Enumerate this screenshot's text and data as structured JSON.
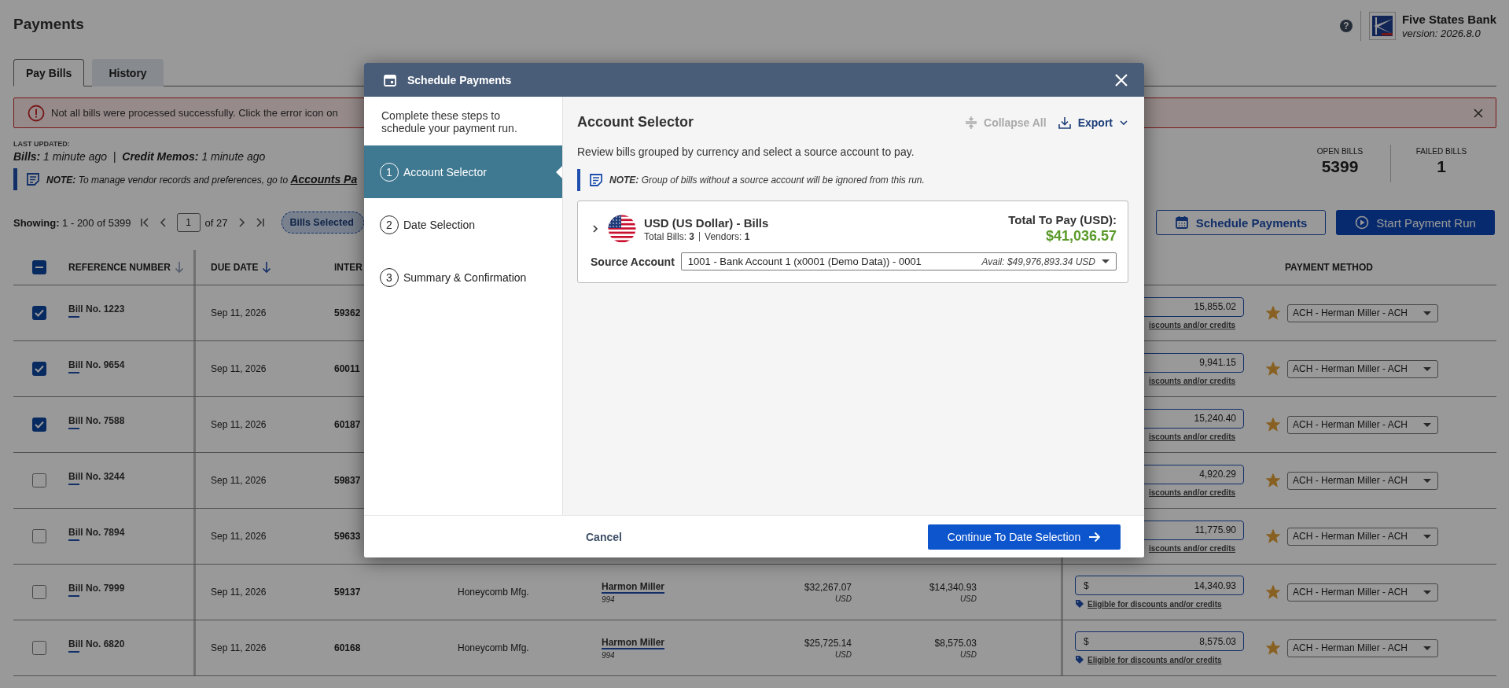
{
  "header": {
    "title": "Payments",
    "help": "?",
    "brand": {
      "name": "Five States Bank",
      "version": "version: 2026.8.0"
    }
  },
  "tabs": [
    {
      "label": "Pay Bills",
      "selected": true
    },
    {
      "label": "History",
      "selected": false
    }
  ],
  "alert": {
    "message": "Not all bills were processed successfully. Click the error icon on"
  },
  "last_updated": {
    "label": "LAST UPDATED:",
    "text": "**Bills:** 1 minute ago  |  **Credit Memos:** 1 minute ago"
  },
  "note": {
    "text": "**NOTE:** To manage vendor records and preferences, go to",
    "link": "Accounts Pa"
  },
  "stats": [
    {
      "label": "OPEN BILLS",
      "value": "5399"
    },
    {
      "label": "FAILED BILLS",
      "value": "1"
    }
  ],
  "pager": {
    "showing": "**Showing:** 1 - 200 of 5399",
    "page": "1",
    "of": "of 27",
    "pill": "Bills Selected"
  },
  "actions": [
    {
      "label": "Schedule Payments",
      "kind": "outline"
    },
    {
      "label": "Start Payment Run",
      "kind": "primary"
    }
  ],
  "table": {
    "indeterminate": true,
    "columns": [
      {
        "label": "REFERENCE NUMBER",
        "sortable": true,
        "sorted": false
      },
      {
        "label": "DUE DATE",
        "sortable": true,
        "sorted": true
      },
      {
        "label": "INTER",
        "sortable": false
      },
      {
        "label": "PAYMENT METHOD",
        "sortable": false
      }
    ],
    "rows": [
      {
        "checked": true,
        "reference": "Bill No. 1223",
        "due_date": "Sep 11, 2026",
        "column_3": "59362",
        "column_8": {
          "value": "15,855.02"
        },
        "link": {
          "text": "iscounts and/or credits",
          "tag_icon": false
        },
        "preferred": true,
        "payment_method": "ACH - Herman Miller - ACH"
      },
      {
        "checked": true,
        "reference": "Bill No. 9654",
        "due_date": "Sep 11, 2026",
        "column_3": "60011",
        "column_8": {
          "value": "9,941.15"
        },
        "link": {
          "text": "iscounts and/or credits",
          "tag_icon": false
        },
        "preferred": true,
        "payment_method": "ACH - Herman Miller - ACH"
      },
      {
        "checked": true,
        "reference": "Bill No. 7588",
        "due_date": "Sep 11, 2026",
        "column_3": "60187",
        "column_8": {
          "value": "15,240.40"
        },
        "link": {
          "text": "iscounts and/or credits",
          "tag_icon": false
        },
        "preferred": true,
        "payment_method": "ACH - Herman Miller - ACH"
      },
      {
        "checked": false,
        "reference": "Bill No. 3244",
        "due_date": "Sep 11, 2026",
        "column_3": "59837",
        "column_8": {
          "value": "4,920.29"
        },
        "link": {
          "text": "iscounts and/or credits",
          "tag_icon": false
        },
        "preferred": true,
        "payment_method": "ACH - Herman Miller - ACH"
      },
      {
        "checked": false,
        "reference": "Bill No. 7894",
        "due_date": "Sep 11, 2026",
        "column_3": "59633",
        "column_8": {
          "value": "11,775.90"
        },
        "link": {
          "text": "iscounts and/or credits",
          "tag_icon": false
        },
        "preferred": true,
        "payment_method": "ACH - Herman Miller - ACH"
      },
      {
        "checked": false,
        "reference": "Bill No. 7999",
        "due_date": "Sep 11, 2026",
        "column_3": "59137",
        "column_4": "Honeycomb Mfg.",
        "column_5": {
          "name": "Harmon Miller",
          "sub": "994"
        },
        "column_6": {
          "value": "$32,267.07",
          "unit": "USD"
        },
        "column_7": {
          "value": "$14,340.93",
          "unit": "USD"
        },
        "column_8": {
          "prefix": "$",
          "value": "14,340.93"
        },
        "link": {
          "text": "Eligible for discounts and/or credits",
          "tag_icon": true
        },
        "preferred": true,
        "payment_method": "ACH - Herman Miller - ACH"
      },
      {
        "checked": false,
        "reference": "Bill No. 6820",
        "due_date": "Sep 11, 2026",
        "column_3": "60168",
        "column_4": "Honeycomb Mfg.",
        "column_5": {
          "name": "Harmon Miller",
          "sub": "994"
        },
        "column_6": {
          "value": "$25,725.14",
          "unit": "USD"
        },
        "column_7": {
          "value": "$8,575.03",
          "unit": "USD"
        },
        "column_8": {
          "prefix": "$",
          "value": "8,575.03"
        },
        "link": {
          "text": "Eligible for discounts and/or credits",
          "tag_icon": true
        },
        "preferred": true,
        "payment_method": "ACH - Herman Miller - ACH"
      }
    ]
  },
  "modal": {
    "title": "Schedule Payments",
    "intro": "Complete these steps to schedule your payment run.",
    "steps": [
      {
        "number": "1",
        "label": "Account Selector",
        "selected": true
      },
      {
        "number": "2",
        "label": "Date Selection",
        "selected": false
      },
      {
        "number": "3",
        "label": "Summary & Confirmation",
        "selected": false
      }
    ],
    "heading": "Account Selector",
    "tools": [
      {
        "label": "Collapse All",
        "kind": "collapse",
        "disabled": true
      },
      {
        "label": "Export",
        "kind": "export",
        "disabled": false
      }
    ],
    "description": "Review bills grouped by currency and select a source account to pay.",
    "note": "**NOTE:** Group of bills without a source account will be ignored from this run.",
    "groups": [
      {
        "title": "USD (US Dollar) - Bills",
        "expanded": false,
        "bills": "Total Bills: **3**",
        "vendors": "Vendors: **1**",
        "total_label": "Total To Pay (USD):",
        "total": "$41,036.57",
        "source_label": "Source Account",
        "source_account": "1001 - Bank Account 1 (x0001 (Demo Data)) - 0001",
        "available": "Avail: $49,976,893.34 USD"
      }
    ],
    "cancel": "Cancel",
    "continue": "Continue To Date Selection"
  }
}
